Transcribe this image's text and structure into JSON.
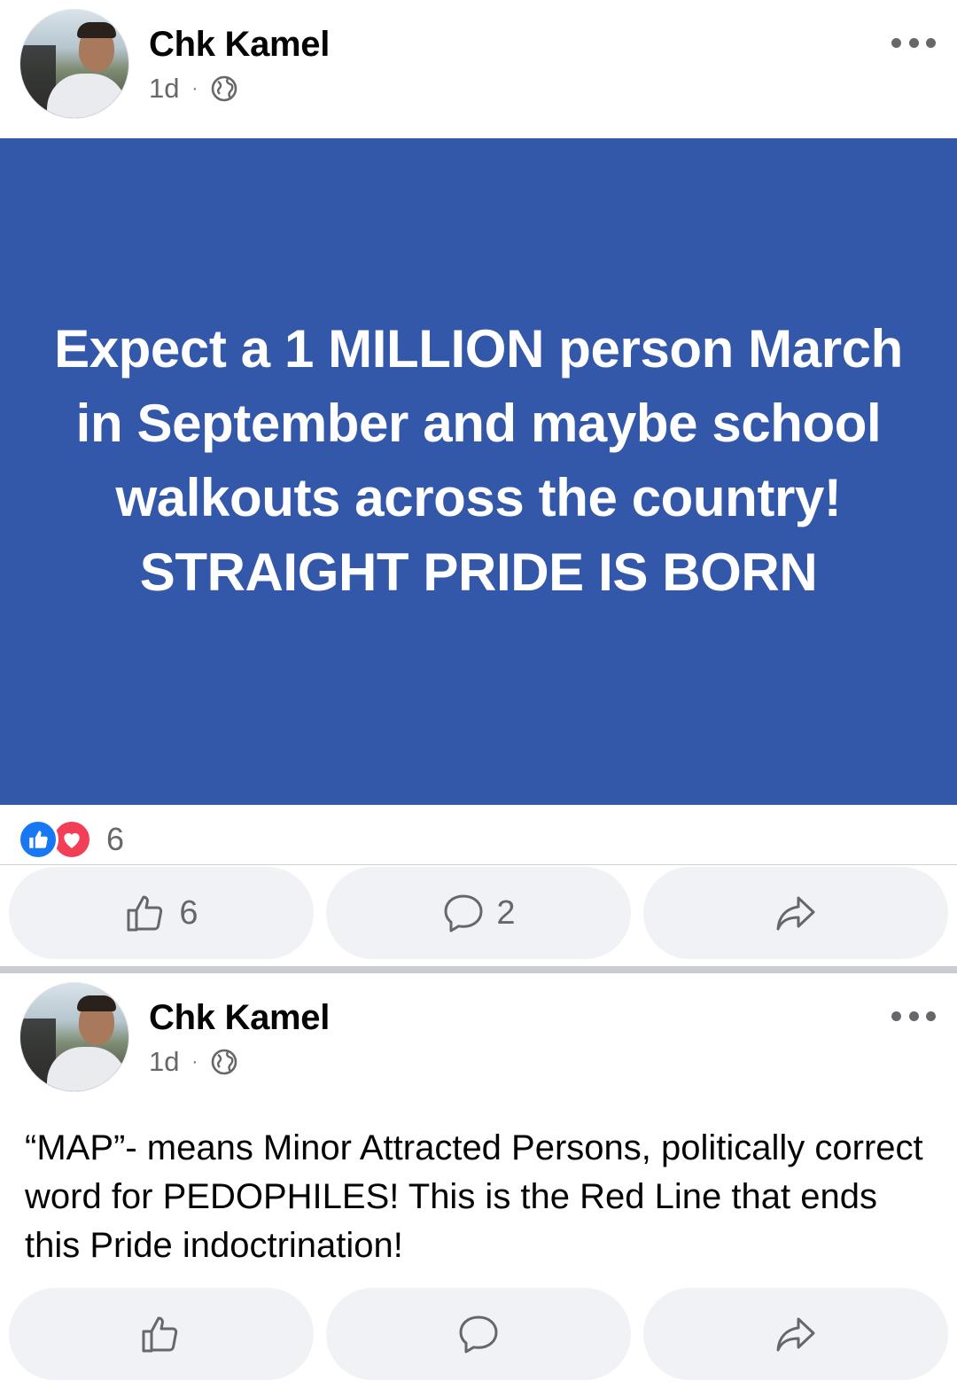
{
  "posts": [
    {
      "author": "Chk Kamel",
      "time": "1d",
      "separator": "·",
      "banner_text": "Expect a 1 MILLION person March in September and maybe school walkouts across the country!\nSTRAIGHT PRIDE IS BORN",
      "reaction_count": "6",
      "reaction_types": [
        "like-icon",
        "love-icon"
      ],
      "like_count": "6",
      "comment_count": "2",
      "banner_color": "#3458a9"
    },
    {
      "author": "Chk Kamel",
      "time": "1d",
      "separator": "·",
      "text": "“MAP”- means Minor Attracted Persons, politically correct word for PEDOPHILES!  This is the Red Line that ends this Pride indoctrination!"
    }
  ],
  "icons": {
    "more": "more-options-icon",
    "privacy": "globe-icon",
    "like": "thumbs-up-icon",
    "comment": "comment-bubble-icon",
    "share": "share-arrow-icon"
  }
}
